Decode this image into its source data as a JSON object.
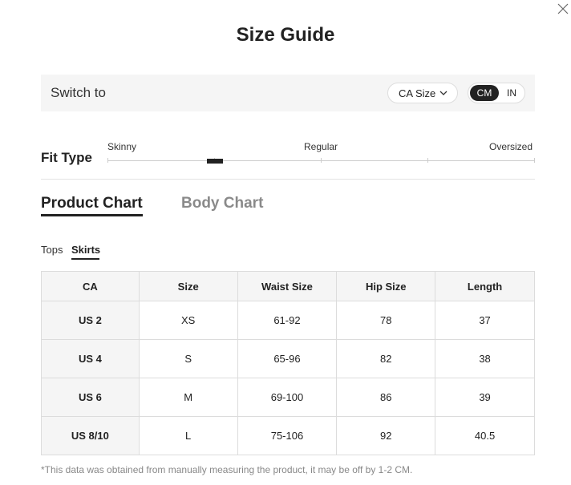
{
  "modal": {
    "title": "Size Guide"
  },
  "switch": {
    "label": "Switch to",
    "region": "CA Size",
    "units": {
      "active": "CM",
      "inactive": "IN"
    }
  },
  "fit": {
    "label": "Fit Type",
    "options": [
      "Skinny",
      "Regular",
      "Oversized"
    ]
  },
  "chart_tabs": {
    "active": "Product Chart",
    "inactive": "Body Chart"
  },
  "sub_tabs": {
    "inactive": "Tops",
    "active": "Skirts"
  },
  "table": {
    "headers": [
      "CA",
      "Size",
      "Waist Size",
      "Hip Size",
      "Length"
    ],
    "rows": [
      [
        "US 2",
        "XS",
        "61-92",
        "78",
        "37"
      ],
      [
        "US 4",
        "S",
        "65-96",
        "82",
        "38"
      ],
      [
        "US 6",
        "M",
        "69-100",
        "86",
        "39"
      ],
      [
        "US 8/10",
        "L",
        "75-106",
        "92",
        "40.5"
      ]
    ]
  },
  "footnote": "*This data was obtained from manually measuring the product, it may be off by 1-2 CM.",
  "icons": {
    "close": "close-icon",
    "dropdown": "chevron-down-icon"
  }
}
